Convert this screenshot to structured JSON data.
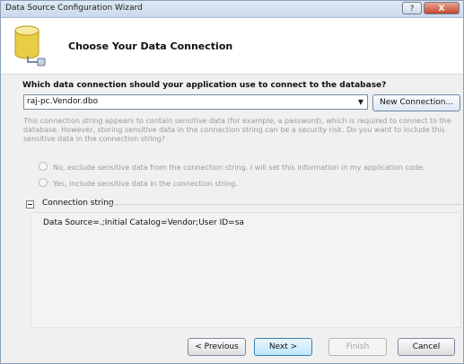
{
  "window": {
    "title": "Data Source Configuration Wizard",
    "help_label": "?",
    "close_label": "X"
  },
  "header": {
    "title": "Choose Your Data Connection",
    "icon": "database-icon"
  },
  "connection": {
    "question": "Which data connection should your application use to connect to the database?",
    "selected": "raj-pc.Vendor.dbo",
    "new_connection_label": "New Connection..."
  },
  "sensitive": {
    "description": "This connection string appears to contain sensitive data (for example, a password), which is required to connect to the database. However, storing sensitive data in the connection string can be a security risk. Do you want to include this sensitive data in the connection string?",
    "option_no": "No, exclude sensitive data from the connection string. I will set this information in my application code.",
    "option_yes": "Yes, include sensitive data in the connection string."
  },
  "connection_string": {
    "label": "Connection string",
    "value": "Data Source=.;Initial Catalog=Vendor;User ID=sa"
  },
  "buttons": {
    "previous": "< Previous",
    "next": "Next >",
    "finish": "Finish",
    "cancel": "Cancel"
  },
  "colors": {
    "titlebar": "#c9d9ec",
    "close_button": "#c6452a",
    "disabled_text": "#9a9a9a"
  }
}
